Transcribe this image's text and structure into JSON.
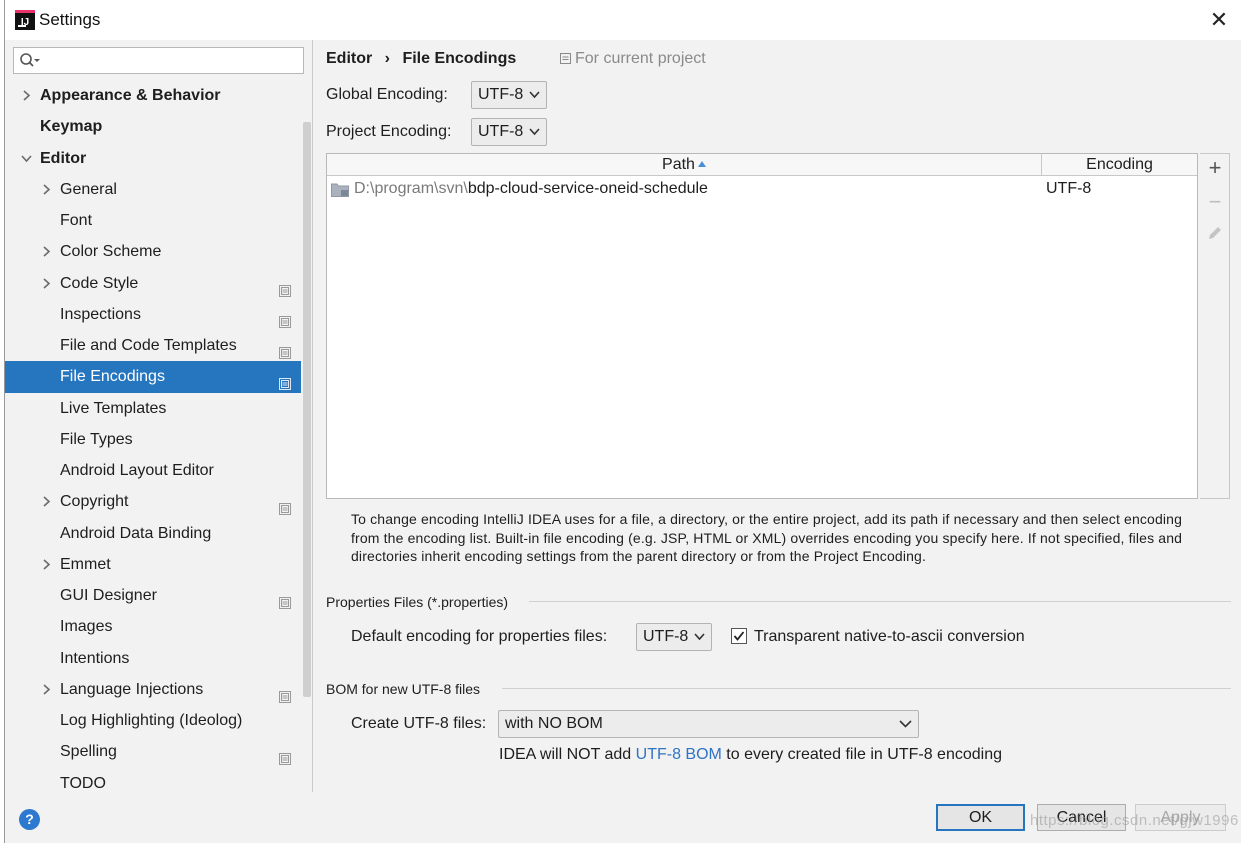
{
  "window": {
    "title": "Settings",
    "close_glyph": "✕"
  },
  "search": {
    "placeholder": "",
    "icon": "search-icon"
  },
  "sidebar": {
    "items": [
      {
        "label": "Appearance & Behavior",
        "level": 0,
        "expandable": true,
        "expanded": false,
        "bold": true,
        "project_scope": false
      },
      {
        "label": "Keymap",
        "level": 0,
        "expandable": false,
        "bold": true,
        "project_scope": false
      },
      {
        "label": "Editor",
        "level": 0,
        "expandable": true,
        "expanded": true,
        "bold": true,
        "project_scope": false
      },
      {
        "label": "General",
        "level": 1,
        "expandable": true,
        "expanded": false,
        "project_scope": false
      },
      {
        "label": "Font",
        "level": 1,
        "expandable": false,
        "project_scope": false
      },
      {
        "label": "Color Scheme",
        "level": 1,
        "expandable": true,
        "expanded": false,
        "project_scope": false
      },
      {
        "label": "Code Style",
        "level": 1,
        "expandable": true,
        "expanded": false,
        "project_scope": true
      },
      {
        "label": "Inspections",
        "level": 1,
        "expandable": false,
        "project_scope": true
      },
      {
        "label": "File and Code Templates",
        "level": 1,
        "expandable": false,
        "project_scope": true
      },
      {
        "label": "File Encodings",
        "level": 1,
        "expandable": false,
        "project_scope": true,
        "selected": true
      },
      {
        "label": "Live Templates",
        "level": 1,
        "expandable": false,
        "project_scope": false
      },
      {
        "label": "File Types",
        "level": 1,
        "expandable": false,
        "project_scope": false
      },
      {
        "label": "Android Layout Editor",
        "level": 1,
        "expandable": false,
        "project_scope": false
      },
      {
        "label": "Copyright",
        "level": 1,
        "expandable": true,
        "expanded": false,
        "project_scope": true
      },
      {
        "label": "Android Data Binding",
        "level": 1,
        "expandable": false,
        "project_scope": false
      },
      {
        "label": "Emmet",
        "level": 1,
        "expandable": true,
        "expanded": false,
        "project_scope": false
      },
      {
        "label": "GUI Designer",
        "level": 1,
        "expandable": false,
        "project_scope": true
      },
      {
        "label": "Images",
        "level": 1,
        "expandable": false,
        "project_scope": false
      },
      {
        "label": "Intentions",
        "level": 1,
        "expandable": false,
        "project_scope": false
      },
      {
        "label": "Language Injections",
        "level": 1,
        "expandable": true,
        "expanded": false,
        "project_scope": true
      },
      {
        "label": "Log Highlighting (Ideolog)",
        "level": 1,
        "expandable": false,
        "project_scope": false
      },
      {
        "label": "Spelling",
        "level": 1,
        "expandable": false,
        "project_scope": true
      },
      {
        "label": "TODO",
        "level": 1,
        "expandable": false,
        "project_scope": false
      }
    ]
  },
  "header": {
    "breadcrumb_parent": "Editor",
    "breadcrumb_separator": "›",
    "breadcrumb_current": "File Encodings",
    "scope_note": "For current project"
  },
  "encodings": {
    "global_label": "Global Encoding:",
    "global_value": "UTF-8",
    "project_label": "Project Encoding:",
    "project_value": "UTF-8"
  },
  "table": {
    "columns": [
      "Path",
      "Encoding"
    ],
    "sorted_column": "Path",
    "rows": [
      {
        "path_prefix": "D:\\program\\svn\\",
        "path_name": "bdp-cloud-service-oneid-schedule",
        "encoding": "UTF-8"
      }
    ],
    "toolbar": {
      "add": "+",
      "remove": "−",
      "edit": "edit-icon"
    }
  },
  "hint": {
    "text": "To change encoding IntelliJ IDEA uses for a file, a directory, or the entire project, add its path if necessary and then select encoding from the encoding list. Built-in file encoding (e.g. JSP, HTML or XML) overrides encoding you specify here. If not specified, files and directories inherit encoding settings from the parent directory or from the Project Encoding."
  },
  "properties": {
    "section_title": "Properties Files (*.properties)",
    "default_label": "Default encoding for properties files:",
    "default_value": "UTF-8",
    "transparent_label": "Transparent native-to-ascii conversion",
    "transparent_checked": true
  },
  "bom": {
    "section_title": "BOM for new UTF-8 files",
    "create_label": "Create UTF-8 files:",
    "create_value": "with NO BOM",
    "note_prefix": "IDEA will NOT add ",
    "note_link": "UTF-8 BOM",
    "note_suffix": " to every created file in UTF-8 encoding"
  },
  "footer": {
    "help": "?",
    "ok": "OK",
    "cancel": "Cancel",
    "apply": "Apply",
    "watermark": "https://blog.csdn.net/gjw1996"
  },
  "colors": {
    "selection": "#2675bf",
    "link": "#2f73c4",
    "help_button": "#2d79cf",
    "panel": "#f2f2f2"
  }
}
